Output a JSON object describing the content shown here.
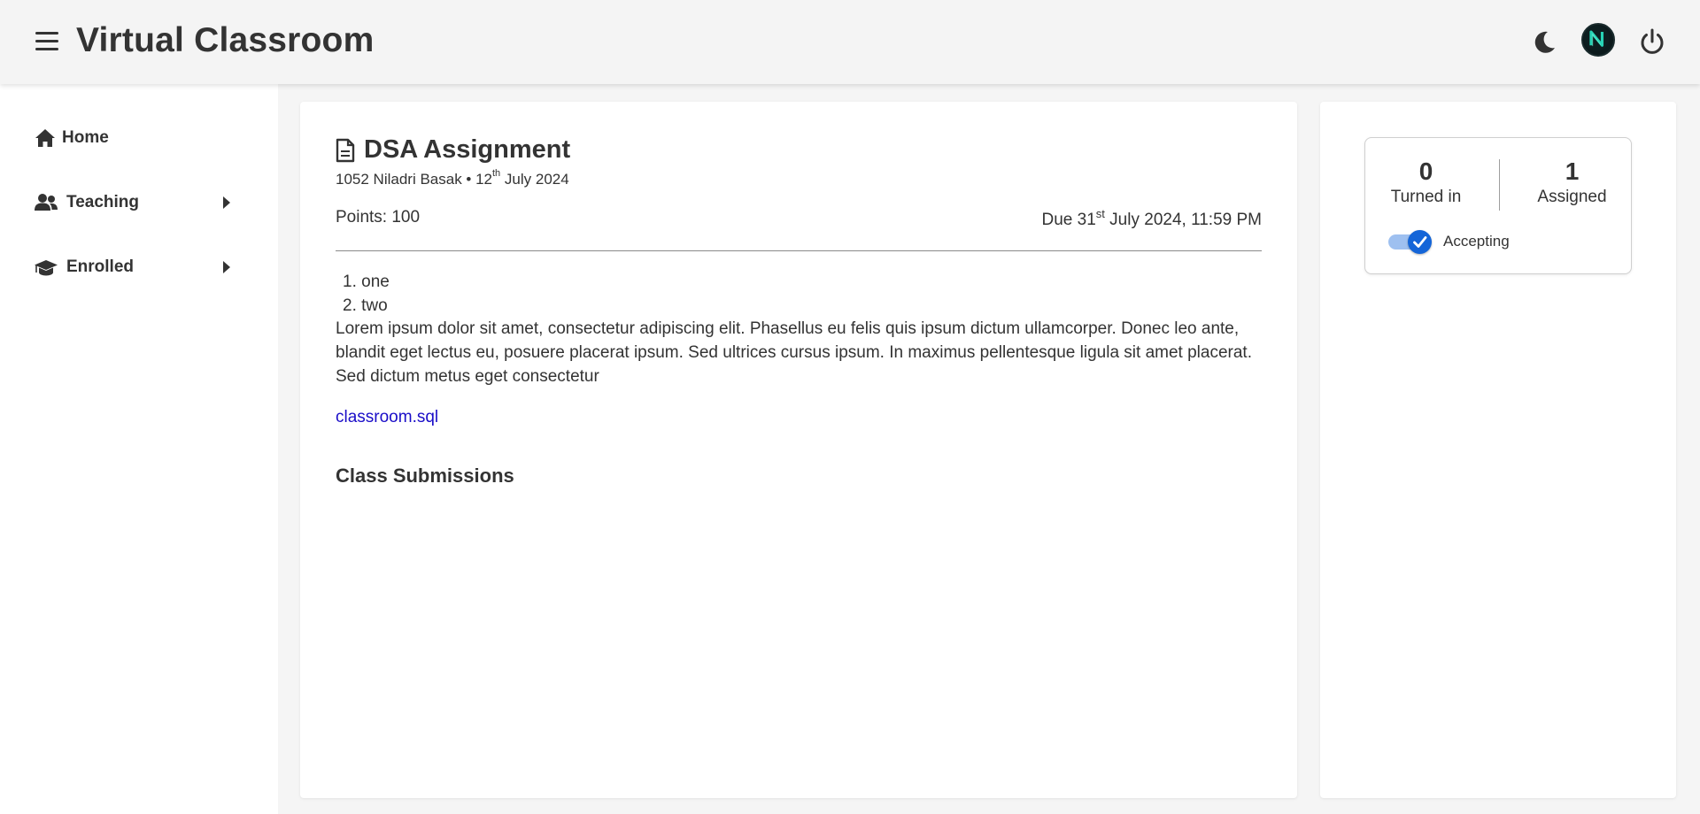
{
  "header": {
    "title": "Virtual Classroom",
    "icons": {
      "menu": "hamburger-menu-icon",
      "theme": "moon-icon",
      "avatar": "avatar-logo",
      "power": "power-icon"
    }
  },
  "sidebar": {
    "items": [
      {
        "label": "Home",
        "icon": "home-icon",
        "expandable": false
      },
      {
        "label": "Teaching",
        "icon": "users-icon",
        "expandable": true
      },
      {
        "label": "Enrolled",
        "icon": "graduation-cap-icon",
        "expandable": true
      }
    ]
  },
  "assignment": {
    "title": "DSA Assignment",
    "meta_prefix": "1052 Niladri Basak • 12",
    "meta_sup": "th",
    "meta_suffix": " July 2024",
    "points": "Points: 100",
    "due_prefix": "Due 31",
    "due_sup": "st",
    "due_suffix": " July 2024, 11:59 PM",
    "list_items": [
      "1. one",
      "2. two"
    ],
    "description": "Lorem ipsum dolor sit amet, consectetur adipiscing elit. Phasellus eu felis quis ipsum dictum ullamcorper. Donec leo ante, blandit eget lectus eu, posuere placerat ipsum. Sed ultrices cursus ipsum. In maximus pellentesque ligula sit amet placerat. Sed dictum metus eget consectetur",
    "attachment": "classroom.sql",
    "submissions_heading": "Class Submissions"
  },
  "stats": {
    "turned_in_count": "0",
    "turned_in_label": "Turned in",
    "assigned_count": "1",
    "assigned_label": "Assigned",
    "accepting_label": "Accepting",
    "accepting_on": true
  },
  "colors": {
    "link": "#1a0dc8",
    "toggle_accent": "#1465d8",
    "toggle_track": "#9ec0f0",
    "text": "#333333",
    "header_bg": "#f4f4f4"
  }
}
